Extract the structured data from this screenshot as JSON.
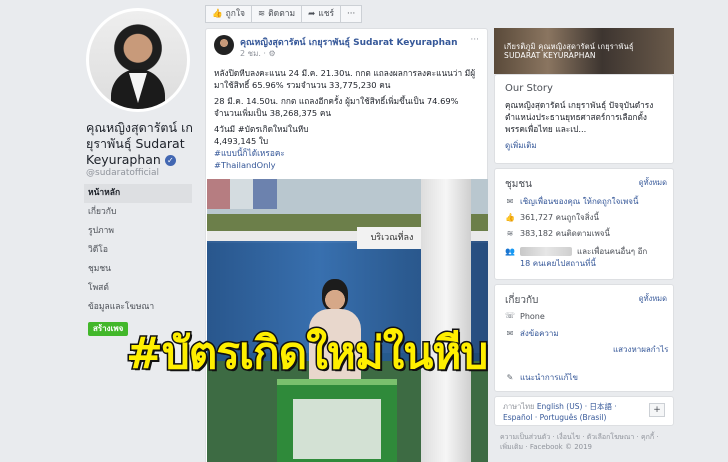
{
  "profile": {
    "name": "คุณหญิงสุดารัตน์ เกยุราพันธุ์ Sudarat Keyuraphan",
    "handle": "@sudaratofficial",
    "verified_icon": "verified-check-icon"
  },
  "nav": {
    "items": [
      "หน้าหลัก",
      "เกี่ยวกับ",
      "รูปภาพ",
      "วิดีโอ",
      "ชุมชน",
      "โพสต์",
      "ข้อมูลและโฆษณา"
    ],
    "active_index": 0,
    "create_label": "สร้างเพจ"
  },
  "actions": {
    "like": "ถูกใจ",
    "follow": "ติดตาม",
    "share": "แชร์",
    "more": "···"
  },
  "post": {
    "author": "คุณหญิงสุดารัตน์ เกยุราพันธุ์ Sudarat Keyuraphan",
    "time": "2 ชม. · ⚙",
    "paragraph1": "หลังปิดหีบลงคะแนน 24 มี.ค. 21.30น. กกต แถลงผลการลงคะแนนว่า มีผู้มาใช้สิทธิ์ 65.96% รวมจำนวน 33,775,230 คน",
    "paragraph2": "28 มี.ค. 14.50น. กกต แถลงอีกครั้ง ผู้มาใช้สิทธิ์เพิ่มขึ้นเป็น 74.69% จำนวนเพิ่มเป็น 38,268,375 คน",
    "line3": "4วันมี #บัตรเกิดใหม่ในหีบ",
    "line4": "4,493,145 ใบ",
    "tag1": "#แบบนี้ก็ได้เหรอคะ",
    "tag2": "#ThailandOnly",
    "photo_sign": "บริเวณที่ลง"
  },
  "cover": {
    "text_line1": "เกียรติภูมิ คุณหญิงสุดารัตน์ เกยุราพันธุ์",
    "text_line2": "SUDARAT KEYURAPHAN"
  },
  "our_story": {
    "title": "Our Story",
    "text": "คุณหญิงสุดารัตน์ เกยุราพันธุ์ ปัจจุบันดำรงตำแหน่งประธานยุทธศาสตร์การเลือกตั้ง พรรคเพื่อไทย และเป...",
    "more": "ดูเพิ่มเติม"
  },
  "community": {
    "title": "ชุมชน",
    "see_all": "ดูทั้งหมด",
    "invite": "เชิญเพื่อนของคุณ ให้กดถูกใจเพจนี้",
    "likes": "361,727 คนถูกใจสิ่งนี้",
    "follows": "383,182 คนติดตามเพจนี้",
    "friends": "และเพื่อนคนอื่นๆ อีก",
    "checkins": "18 คนเคยไปสถานที่นี้"
  },
  "about": {
    "title": "เกี่ยวกับ",
    "see_all": "ดูทั้งหมด",
    "phone": "Phone",
    "send_message": "ส่งข้อความ",
    "suggest": "แนะนำการแก้ไข",
    "interests": "แสวงหาผลกำไร"
  },
  "languages": {
    "current": "ภาษาไทย",
    "options": "English (US) · 日本語 · Español · Português (Brasil)",
    "add": "+"
  },
  "footer": {
    "text": "ความเป็นส่วนตัว · เงื่อนไข · ตัวเลือกโฆษณา · คุกกี้ · เพิ่มเติม · Facebook © 2019"
  },
  "overlay": {
    "hashtag": "#บัตรเกิดใหม่ในหีบ"
  },
  "colors": {
    "fb_blue": "#4267b2",
    "link": "#365899",
    "green": "#42b72a",
    "overlay_yellow": "#ffef00"
  }
}
